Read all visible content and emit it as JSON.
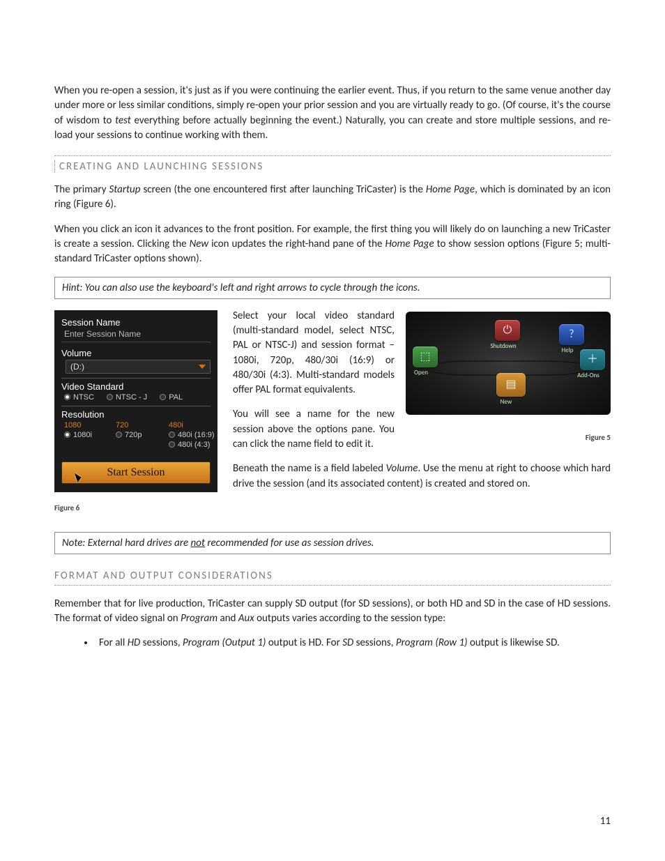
{
  "para1": "When you re-open a session, it's just as if you were continuing the earlier event.  Thus, if you return to the same venue another day under more or less similar conditions, simply re-open your prior session and you are virtually ready to go. (Of course, it's the course of wisdom to ",
  "para1_italic": "test",
  "para1_after": " everything before actually beginning the event.) Naturally, you can create and store multiple sessions, and re-load your sessions to continue working with them.",
  "heading1": "CREATING AND LAUNCHING SESSIONS",
  "para2_a": "The primary ",
  "para2_i1": "Startup",
  "para2_b": " screen (the one encountered first after launching TriCaster) is the ",
  "para2_i2": "Home Page",
  "para2_c": ", which is dominated by an icon ring (Figure 6).",
  "para3_a": "When you click an icon it advances to the front position. For example, the first thing you will likely do on launching a new TriCaster is create a session.  Clicking the ",
  "para3_i1": "New",
  "para3_b": " icon updates the right-hand pane of the ",
  "para3_i2": "Home Page",
  "para3_c": " to show session options (Figure 5; multi-standard TriCaster options shown).",
  "hint": "Hint: You can also use the keyboard's left and right arrows to cycle through the icons.",
  "fig6": {
    "session_name_label": "Session Name",
    "session_name_placeholder": "Enter Session Name",
    "volume_label": "Volume",
    "volume_value": "(D:)",
    "video_standard_label": "Video Standard",
    "std_opts": [
      "NTSC",
      "NTSC - J",
      "PAL"
    ],
    "std_selected": 0,
    "resolution_label": "Resolution",
    "res_headers": [
      "1080",
      "720",
      "480i"
    ],
    "res_opts": [
      {
        "col": 0,
        "label": "1080i",
        "selected": true
      },
      {
        "col": 1,
        "label": "720p",
        "selected": false
      },
      {
        "col": 2,
        "label": "480i (16:9)",
        "selected": false
      },
      {
        "col": 2,
        "label": "480i (4:3)",
        "selected": false
      }
    ],
    "start_button": "Start Session",
    "caption": "Figure 6"
  },
  "fig5": {
    "icons": {
      "shutdown": "Shutdown",
      "help": "Help",
      "addons": "Add-Ons",
      "new": "New",
      "open": "Open"
    },
    "caption": "Figure 5"
  },
  "midtext": {
    "p1": "Select your local video standard (multi-standard model, select NTSC, PAL or NTSC-J) and session format –1080i, 720p, 480/30i (16:9) or 480/30i (4:3). Multi-standard models offer PAL format equivalents.",
    "p2": "You will see a name for the new session above the options pane.  You can click the name field to edit it.",
    "p3_a": "Beneath the name is a field labeled ",
    "p3_i": "Volume",
    "p3_b": ".  Use the menu at right to choose which hard drive the session (and its associated content) is created and stored on."
  },
  "note_a": "Note: External hard drives are ",
  "note_u": "not",
  "note_b": " recommended for use as session drives.",
  "heading2": "FORMAT AND OUTPUT CONSIDERATIONS",
  "para_out_a": "Remember that for live production, TriCaster can supply SD output (for SD sessions), or both HD and SD in the case of HD sessions.  The format of video signal on ",
  "para_out_i1": "Program",
  "para_out_b": " and ",
  "para_out_i2": "Aux",
  "para_out_c": " outputs varies according to the session type:",
  "bullet1_a": "For all ",
  "bullet1_i1": "HD",
  "bullet1_b": " sessions, ",
  "bullet1_i2": "Program (Output 1)",
  "bullet1_c": " output is HD. For ",
  "bullet1_i3": "SD",
  "bullet1_d": " sessions, ",
  "bullet1_i4": "Program (Row 1)",
  "bullet1_e": " output is likewise SD.",
  "page_number": "11"
}
